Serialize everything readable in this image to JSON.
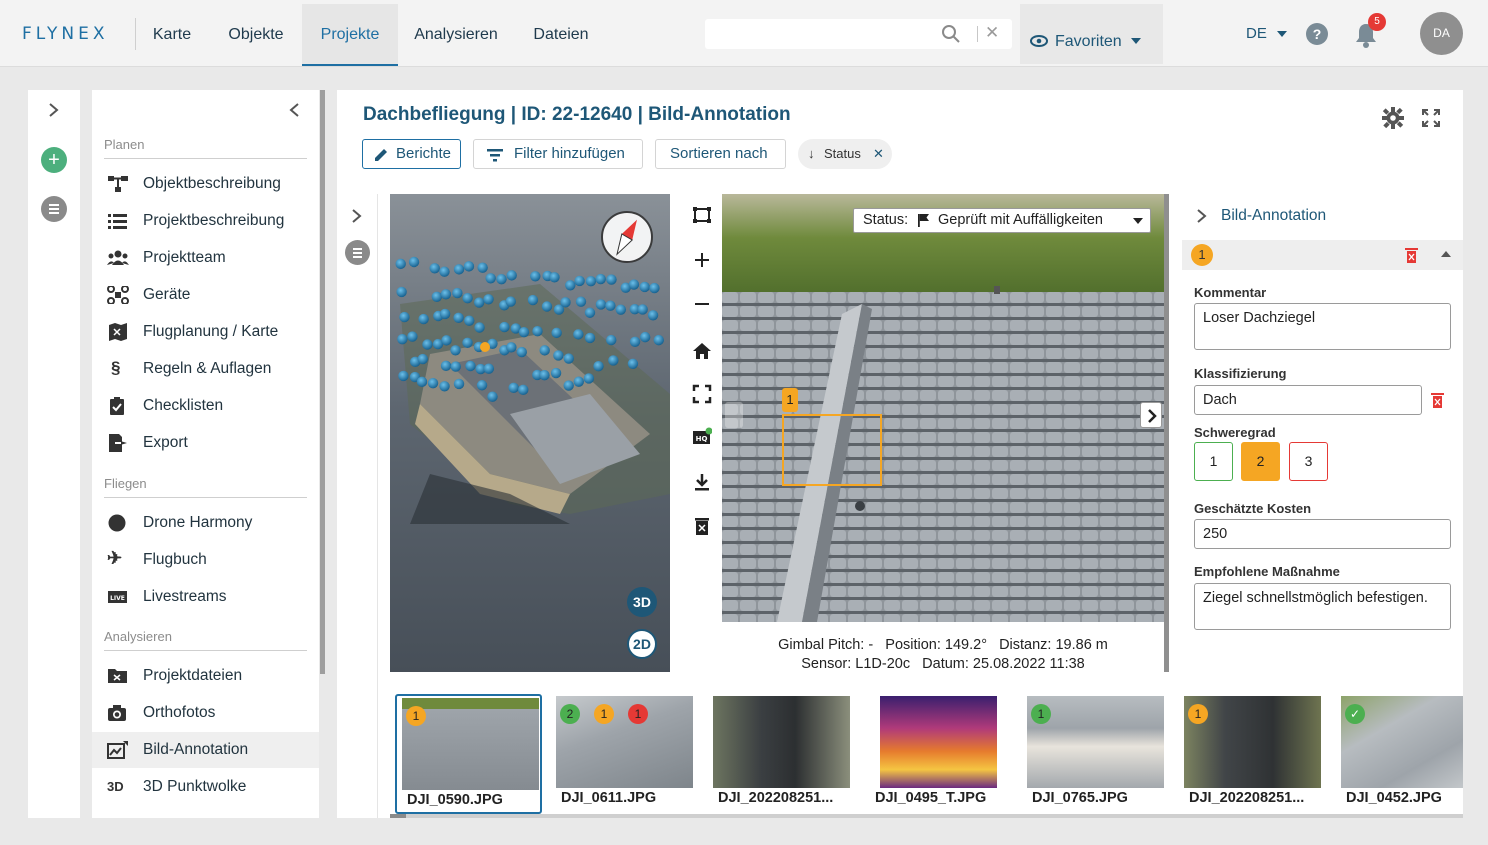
{
  "nav": {
    "logo": "FLYNEX",
    "tabs": [
      {
        "label": "Karte"
      },
      {
        "label": "Objekte"
      },
      {
        "label": "Projekte",
        "active": true
      },
      {
        "label": "Analysieren"
      },
      {
        "label": "Dateien"
      }
    ],
    "search_value": "",
    "favorites_label": "Favoriten",
    "language": "DE",
    "notification_count": "5",
    "avatar_initials": "DA"
  },
  "sidebar": {
    "sections": [
      {
        "title": "Planen",
        "items": [
          {
            "label": "Objektbeschreibung",
            "icon": "hierarchy-icon"
          },
          {
            "label": "Projektbeschreibung",
            "icon": "list-icon"
          },
          {
            "label": "Projektteam",
            "icon": "team-icon"
          },
          {
            "label": "Geräte",
            "icon": "drone-icon"
          },
          {
            "label": "Flugplanung / Karte",
            "icon": "map-plan-icon"
          },
          {
            "label": "Regeln & Auflagen",
            "icon": "paragraph-icon"
          },
          {
            "label": "Checklisten",
            "icon": "clipboard-icon"
          },
          {
            "label": "Export",
            "icon": "export-icon"
          }
        ]
      },
      {
        "title": "Fliegen",
        "items": [
          {
            "label": "Drone Harmony",
            "icon": "circle-icon"
          },
          {
            "label": "Flugbuch",
            "icon": "plane-icon"
          },
          {
            "label": "Livestreams",
            "icon": "live-icon"
          }
        ]
      },
      {
        "title": "Analysieren",
        "items": [
          {
            "label": "Projektdateien",
            "icon": "folder-icon"
          },
          {
            "label": "Orthofotos",
            "icon": "camera-icon"
          },
          {
            "label": "Bild-Annotation",
            "icon": "annotation-icon",
            "active": true
          },
          {
            "label": "3D Punktwolke",
            "icon": "3d-icon",
            "icon_text": "3D"
          }
        ]
      }
    ]
  },
  "main": {
    "title": "Dachbefliegung | ID: 22-12640 | Bild-Annotation",
    "buttons": {
      "reports": "Berichte",
      "filter": "Filter hinzufügen",
      "sort": "Sortieren nach",
      "status_chip": "Status"
    }
  },
  "viewer": {
    "btn_3d": "3D",
    "btn_2d": "2D",
    "status_label": "Status:",
    "status_value": "Geprüft mit Auffälligkeiten",
    "annotation_marker": "1",
    "info_line1": "Gimbal Pitch: -   Position: 149.2°   Distanz: 19.86 m",
    "info_line2": "Sensor: L1D-20c   Datum: 25.08.2022 11:38"
  },
  "annotation": {
    "panel_title": "Bild-Annotation",
    "number": "1",
    "comment_label": "Kommentar",
    "comment_value": "Loser Dachziegel",
    "class_label": "Klassifizierung",
    "class_value": "Dach",
    "severity_label": "Schweregrad",
    "severity_options": [
      "1",
      "2",
      "3"
    ],
    "severity_selected": "2",
    "cost_label": "Geschätzte Kosten",
    "cost_value": "250",
    "measure_label": "Empfohlene Maßnahme",
    "measure_value": "Ziegel schnellstmöglich befestigen."
  },
  "thumbnails": [
    {
      "name": "DJI_0590.JPG",
      "badges": [
        {
          "text": "1",
          "color": "#f5a623"
        }
      ],
      "selected": true
    },
    {
      "name": "DJI_0611.JPG",
      "badges": [
        {
          "text": "2",
          "color": "#4caf50"
        },
        {
          "text": "1",
          "color": "#f5a623"
        },
        {
          "text": "1",
          "color": "#e53935"
        }
      ]
    },
    {
      "name": "DJI_202208251...",
      "badges": []
    },
    {
      "name": "DJI_0495_T.JPG",
      "badges": []
    },
    {
      "name": "DJI_0765.JPG",
      "badges": [
        {
          "text": "1",
          "color": "#4caf50"
        }
      ]
    },
    {
      "name": "DJI_202208251...",
      "badges": [
        {
          "text": "1",
          "color": "#f5a623"
        }
      ]
    },
    {
      "name": "DJI_0452.JPG",
      "badges": [
        {
          "text": "✓",
          "color": "#4caf50"
        }
      ]
    }
  ],
  "colors": {
    "accent": "#1e6fa3",
    "warning": "#f5a623",
    "danger": "#e53935",
    "success": "#4caf50"
  }
}
